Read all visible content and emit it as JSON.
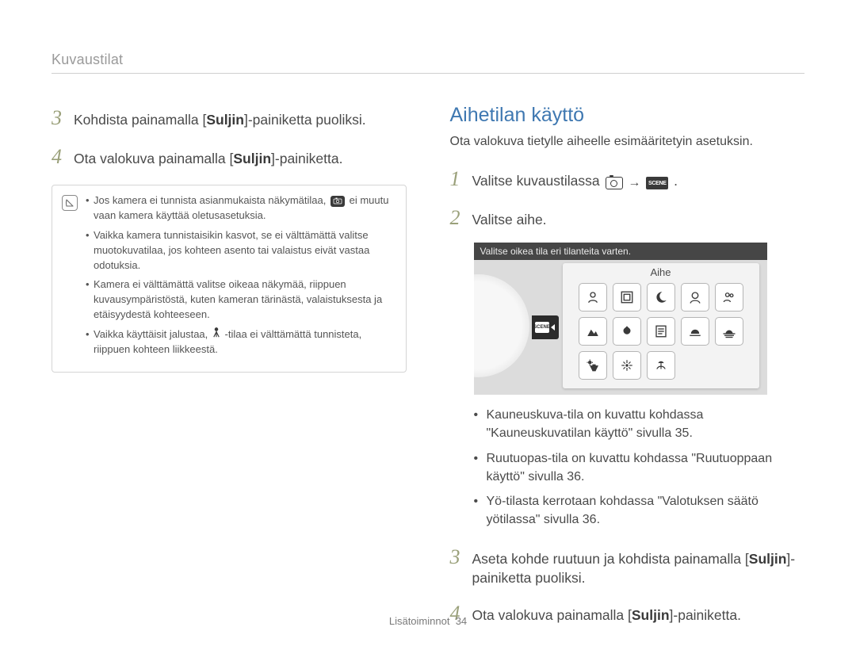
{
  "section_title": "Kuvaustilat",
  "left": {
    "step3": {
      "num": "3",
      "text_pre": "Kohdista painamalla [",
      "bold": "Suljin",
      "text_post": "]-painiketta puoliksi."
    },
    "step4": {
      "num": "4",
      "text_pre": "Ota valokuva painamalla [",
      "bold": "Suljin",
      "text_post": "]-painiketta."
    },
    "note1_a": "Jos kamera ei tunnista asianmukaista näkymätilaa, ",
    "note1_b": " ei muutu vaan kamera käyttää oletusasetuksia.",
    "note2": "Vaikka kamera tunnistaisikin kasvot, se ei välttämättä valitse muotokuvatilaa, jos kohteen asento tai valaistus eivät vastaa odotuksia.",
    "note3": "Kamera ei välttämättä valitse oikeaa näkymää, riippuen kuvausympäristöstä, kuten kameran tärinästä, valaistuksesta ja etäisyydestä kohteeseen.",
    "note4_a": "Vaikka käyttäisit jalustaa, ",
    "note4_b": "-tilaa ei välttämättä tunnisteta, riippuen kohteen liikkeestä."
  },
  "right": {
    "heading": "Aihetilan käyttö",
    "intro": "Ota valokuva tietylle aiheelle esimääritetyin asetuksin.",
    "step1": {
      "num": "1",
      "text": "Valitse kuvaustilassa ",
      "arrow": "→",
      "dot": "."
    },
    "step2": {
      "num": "2",
      "text": "Valitse aihe."
    },
    "scene_caption": "Valitse oikea tila eri tilanteita varten.",
    "scene_label": "Aihe",
    "scene_tab_text": "SCENE",
    "bul1": "Kauneuskuva-tila on kuvattu kohdassa \"Kauneuskuvatilan käyttö\" sivulla 35.",
    "bul2": "Ruutuopas-tila on kuvattu kohdassa \"Ruutuoppaan käyttö\" sivulla 36.",
    "bul3": "Yö-tilasta kerrotaan kohdassa \"Valotuksen säätö yötilassa\" sivulla 36.",
    "step3": {
      "num": "3",
      "text_pre": "Aseta kohde ruutuun ja kohdista painamalla [",
      "bold": "Suljin",
      "text_post": "]-painiketta puoliksi."
    },
    "step4": {
      "num": "4",
      "text_pre": "Ota valokuva painamalla [",
      "bold": "Suljin",
      "text_post": "]-painiketta."
    }
  },
  "footer": {
    "label": "Lisätoiminnot",
    "page": "34"
  }
}
